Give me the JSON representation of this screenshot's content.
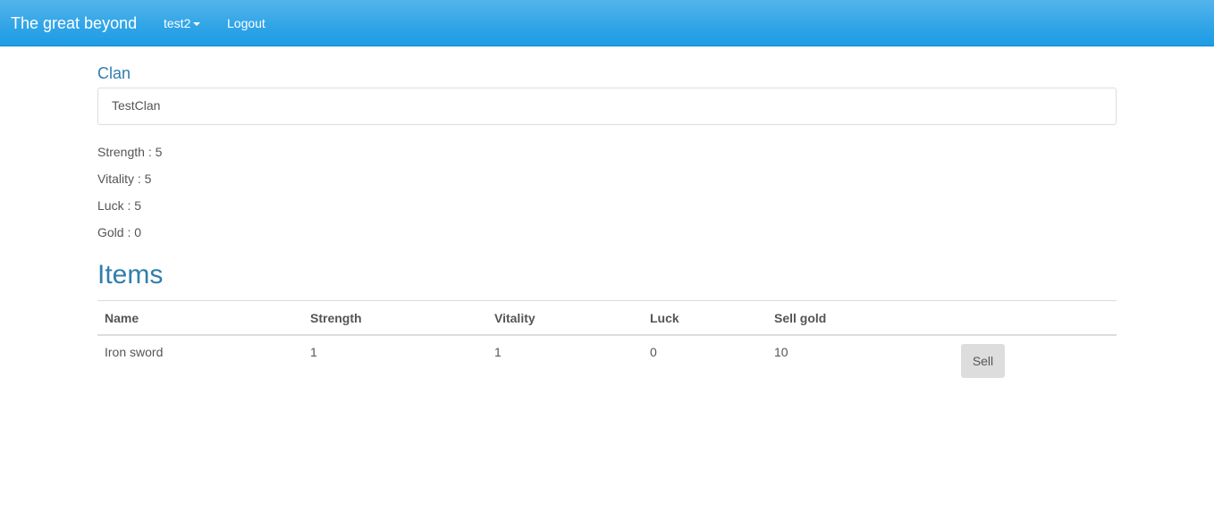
{
  "navbar": {
    "brand": "The great beyond",
    "user_label": "test2",
    "logout_label": "Logout"
  },
  "clan": {
    "heading": "Clan",
    "value": "TestClan"
  },
  "stats": {
    "strength": "Strength : 5",
    "vitality": "Vitality : 5",
    "luck": "Luck : 5",
    "gold": "Gold : 0"
  },
  "items": {
    "heading": "Items",
    "columns": [
      "Name",
      "Strength",
      "Vitality",
      "Luck",
      "Sell gold"
    ],
    "rows": [
      {
        "name": "Iron sword",
        "strength": "1",
        "vitality": "1",
        "luck": "0",
        "sell_gold": "10",
        "action_label": "Sell"
      }
    ]
  },
  "colors": {
    "navbar": "#2fa4e7",
    "heading": "#317eac",
    "text": "#555555"
  }
}
